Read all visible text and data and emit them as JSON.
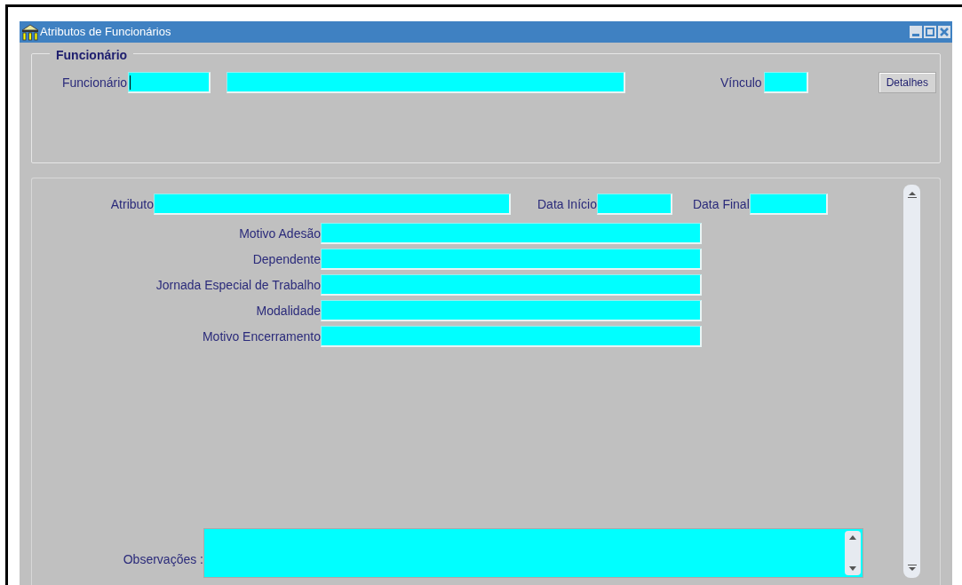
{
  "window": {
    "title": "Atributos de Funcionários"
  },
  "employee_group": {
    "legend": "Funcionário",
    "label": "Funcionário",
    "code_field": {
      "focused": true
    },
    "vinculo_label": "Vínculo",
    "details_button": "Detalhes"
  },
  "attributes": {
    "atributo_label": "Atributo",
    "start_label": "Data Início",
    "end_label": "Data Final",
    "rows": [
      {
        "label": "Motivo Adesão"
      },
      {
        "label": "Dependente"
      },
      {
        "label": "Jornada Especial de Trabalho"
      },
      {
        "label": "Modalidade"
      },
      {
        "label": "Motivo Encerramento"
      }
    ],
    "notes_label": "Observações :"
  }
}
